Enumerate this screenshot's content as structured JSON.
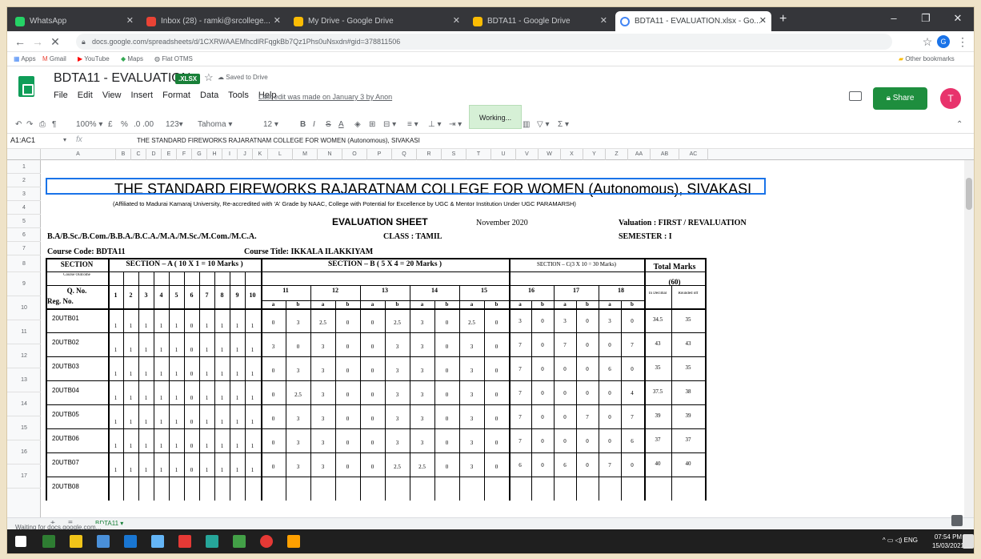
{
  "tabs": [
    {
      "label": "WhatsApp",
      "color": "#25d366"
    },
    {
      "label": "Inbox (28) - ramki@srcollege...",
      "color": "#ea4335"
    },
    {
      "label": "My Drive - Google Drive",
      "color": "#fbbc04"
    },
    {
      "label": "BDTA11 - Google Drive",
      "color": "#fbbc04"
    },
    {
      "label": "BDTA11 - EVALUATION.xlsx - Go...",
      "color": "#4285f4"
    }
  ],
  "url": "docs.google.com/spreadsheets/d/1CXRWAAEMhcdlRFqgkBb7Qz1Phs0uNsxdn#gid=378811506",
  "bookmarks": [
    "Apps",
    "Gmail",
    "YouTube",
    "Maps",
    "Flat OTMS"
  ],
  "other_bookmarks": "Other bookmarks",
  "doc": {
    "title": "BDTA11 - EVALUATION",
    "badge": ".XLSX",
    "save_to_drive": "Saved to Drive",
    "menu": [
      "File",
      "Edit",
      "View",
      "Insert",
      "Format",
      "Data",
      "Tools",
      "Help"
    ],
    "last_edit": "Last edit was made on January 3 by Anon",
    "working": "Working...",
    "share": "Share",
    "avatar_letter": "T"
  },
  "toolbar": {
    "zoom": "100%",
    "currency": "£",
    "percent": "%",
    "decimal": ".0  .00",
    "numformat": "123▾",
    "font": "Tahoma",
    "font_size": "12"
  },
  "formula": {
    "namebox": "A1:AC1",
    "fx": "fx",
    "content": "THE STANDARD FIREWORKS RAJARATNAM COLLEGE FOR WOMEN (Autonomous), SIVAKASI"
  },
  "col_letters": [
    "A",
    "B",
    "C",
    "D",
    "E",
    "F",
    "G",
    "H",
    "I",
    "J",
    "K",
    "L",
    "M",
    "N",
    "O",
    "P",
    "Q",
    "R",
    "S",
    "T",
    "U",
    "V",
    "W",
    "X",
    "Y",
    "Z",
    "AA",
    "AB",
    "AC"
  ],
  "row_numbers": [
    "1",
    "2",
    "3",
    "4",
    "5",
    "6",
    "7",
    "8",
    "9",
    "10",
    "11",
    "12",
    "13",
    "14",
    "15",
    "16",
    "17"
  ],
  "sheet": {
    "college": "THE STANDARD FIREWORKS RAJARATNAM COLLEGE FOR WOMEN (Autonomous), SIVAKASI",
    "affiliation": "(Affiliated to Madurai Kamaraj University, Re-accredited with 'A' Grade by NAAC, College with Potential for Excellence by UGC & Mentor Institution Under UGC PARAMARSH)",
    "eval_title": "EVALUATION SHEET",
    "month": "November 2020",
    "valuation": "Valuation : FIRST / REVALUATION",
    "programmes": "B.A/B.Sc./B.Com./B.B.A./B.C.A./M.A./M.Sc./M.Com./M.C.A.",
    "class": "CLASS : TAMIL",
    "semester": "SEMESTER : I",
    "course_code": "Course Code: BDTA11",
    "course_title": "Course Title: IKKALA ILAKKIYAM",
    "section_label": "SECTION",
    "section_a": "SECTION – A ( 10 X 1 = 10 Marks )",
    "section_b": "SECTION – B ( 5 X 4 = 20 Marks )",
    "section_c": "SECTION – C(3 X 10 = 30 Marks)",
    "total_marks": "Total Marks",
    "total_out_of": "(60)",
    "course_outcome": "Course Outcome",
    "qno": "Q. No.",
    "regno": "Reg. No.",
    "a_nums": [
      "1",
      "2",
      "3",
      "4",
      "5",
      "6",
      "7",
      "8",
      "9",
      "10"
    ],
    "b_nums": [
      "11",
      "12",
      "13",
      "14",
      "15"
    ],
    "c_nums": [
      "16",
      "17",
      "18"
    ],
    "ab": [
      "a",
      "b"
    ],
    "in_decimal": "In Decimal",
    "rounded_off": "Rounded off",
    "rows": [
      {
        "reg": "20UTB01",
        "a": [
          "1",
          "1",
          "1",
          "1",
          "1",
          "0",
          "1",
          "1",
          "1",
          "1"
        ],
        "b": [
          "0",
          "3",
          "2.5",
          "0",
          "0",
          "2.5",
          "3",
          "0",
          "2.5",
          "0"
        ],
        "c": [
          "3",
          "0",
          "3",
          "0",
          "3",
          "0"
        ],
        "dec": "34.5",
        "round": "35"
      },
      {
        "reg": "20UTB02",
        "a": [
          "1",
          "1",
          "1",
          "1",
          "1",
          "0",
          "1",
          "1",
          "1",
          "1"
        ],
        "b": [
          "3",
          "0",
          "3",
          "0",
          "0",
          "3",
          "3",
          "0",
          "3",
          "0"
        ],
        "c": [
          "7",
          "0",
          "7",
          "0",
          "0",
          "7"
        ],
        "dec": "43",
        "round": "43"
      },
      {
        "reg": "20UTB03",
        "a": [
          "1",
          "1",
          "1",
          "1",
          "1",
          "0",
          "1",
          "1",
          "1",
          "1"
        ],
        "b": [
          "0",
          "3",
          "3",
          "0",
          "0",
          "3",
          "3",
          "0",
          "3",
          "0"
        ],
        "c": [
          "7",
          "0",
          "0",
          "0",
          "6",
          "0"
        ],
        "dec": "35",
        "round": "35"
      },
      {
        "reg": "20UTB04",
        "a": [
          "1",
          "1",
          "1",
          "1",
          "1",
          "0",
          "1",
          "1",
          "1",
          "1"
        ],
        "b": [
          "0",
          "2.5",
          "3",
          "0",
          "0",
          "3",
          "3",
          "0",
          "3",
          "0"
        ],
        "c": [
          "7",
          "0",
          "0",
          "0",
          "0",
          "4"
        ],
        "dec": "37.5",
        "round": "38"
      },
      {
        "reg": "20UTB05",
        "a": [
          "1",
          "1",
          "1",
          "1",
          "1",
          "0",
          "1",
          "1",
          "1",
          "1"
        ],
        "b": [
          "0",
          "3",
          "3",
          "0",
          "0",
          "3",
          "3",
          "0",
          "3",
          "0"
        ],
        "c": [
          "7",
          "0",
          "0",
          "7",
          "0",
          "7"
        ],
        "dec": "39",
        "round": "39"
      },
      {
        "reg": "20UTB06",
        "a": [
          "1",
          "1",
          "1",
          "1",
          "1",
          "0",
          "1",
          "1",
          "1",
          "1"
        ],
        "b": [
          "0",
          "3",
          "3",
          "0",
          "0",
          "3",
          "3",
          "0",
          "3",
          "0"
        ],
        "c": [
          "7",
          "0",
          "0",
          "0",
          "0",
          "6"
        ],
        "dec": "37",
        "round": "37"
      },
      {
        "reg": "20UTB07",
        "a": [
          "1",
          "1",
          "1",
          "1",
          "1",
          "0",
          "1",
          "1",
          "1",
          "1"
        ],
        "b": [
          "0",
          "3",
          "3",
          "0",
          "0",
          "2.5",
          "2.5",
          "0",
          "3",
          "0"
        ],
        "c": [
          "6",
          "0",
          "6",
          "0",
          "7",
          "0"
        ],
        "dec": "40",
        "round": "40"
      },
      {
        "reg": "20UTB08",
        "a": [],
        "b": [],
        "c": [],
        "dec": "",
        "round": ""
      }
    ]
  },
  "sheettab": "BDTA11",
  "status": "Waiting for docs.google.com...",
  "tray": "ENG",
  "clock": {
    "time": "07:54 PM",
    "date": "15/03/2021"
  }
}
